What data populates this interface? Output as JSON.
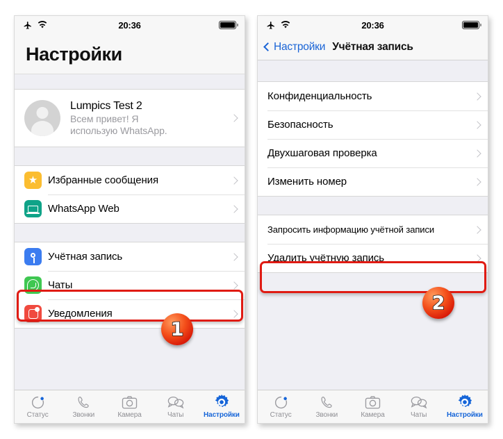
{
  "status_bar": {
    "time": "20:36",
    "airplane_icon": "airplane-icon",
    "wifi_icon": "wifi-icon",
    "battery_icon": "battery-full-icon"
  },
  "colors": {
    "accent_blue": "#1665d8",
    "highlight_red": "#e01b13",
    "badge_orange": "#f4501b",
    "star_yellow": "#fbbd30",
    "web_teal": "#0fa388",
    "key_blue": "#3b7cf0",
    "chats_green": "#3fc751",
    "notif_red": "#f04a3f",
    "bg_gray": "#efeff4"
  },
  "left_phone": {
    "title": "Настройки",
    "profile": {
      "name": "Lumpics Test 2",
      "status_line1": "Всем привет! Я",
      "status_line2": "использую WhatsApp.",
      "avatar_icon": "person-placeholder-icon"
    },
    "group1": [
      {
        "label": "Избранные сообщения",
        "icon": "star-icon"
      },
      {
        "label": "WhatsApp Web",
        "icon": "laptop-icon"
      }
    ],
    "group2": [
      {
        "label": "Учётная запись",
        "icon": "key-icon",
        "highlighted": true
      },
      {
        "label": "Чаты",
        "icon": "whatsapp-icon"
      },
      {
        "label": "Уведомления",
        "icon": "notification-icon"
      }
    ]
  },
  "right_phone": {
    "back_label": "Настройки",
    "title": "Учётная запись",
    "group1": [
      {
        "label": "Конфиденциальность"
      },
      {
        "label": "Безопасность"
      },
      {
        "label": "Двухшаговая проверка"
      },
      {
        "label": "Изменить номер"
      }
    ],
    "group2": [
      {
        "label": "Запросить информацию учётной записи",
        "small": true
      },
      {
        "label": "Удалить учётную запись",
        "highlighted": true
      }
    ]
  },
  "tabbar": {
    "items": [
      {
        "label": "Статус",
        "icon": "status-ring-icon",
        "active": false
      },
      {
        "label": "Звонки",
        "icon": "phone-icon",
        "active": false
      },
      {
        "label": "Камера",
        "icon": "camera-icon",
        "active": false
      },
      {
        "label": "Чаты",
        "icon": "chat-bubbles-icon",
        "active": false
      },
      {
        "label": "Настройки",
        "icon": "gear-icon",
        "active": true
      }
    ]
  },
  "annotations": {
    "step1": "1",
    "step2": "2"
  }
}
